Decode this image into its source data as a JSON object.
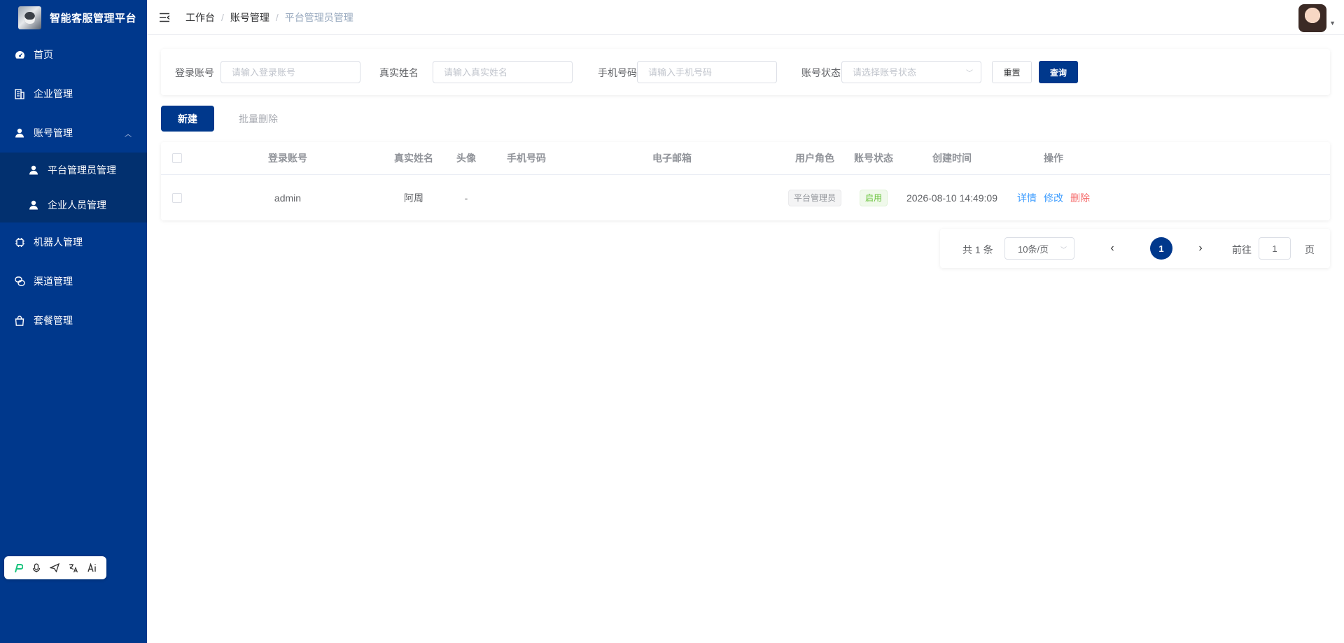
{
  "app": {
    "title": "智能客服管理平台"
  },
  "sidebar": {
    "items": [
      {
        "label": "首页",
        "icon": "dashboard-icon"
      },
      {
        "label": "企业管理",
        "icon": "building-icon"
      },
      {
        "label": "账号管理",
        "icon": "user-icon",
        "expanded": true,
        "children": [
          {
            "label": "平台管理员管理",
            "icon": "user-icon",
            "active": true
          },
          {
            "label": "企业人员管理",
            "icon": "user-icon"
          }
        ]
      },
      {
        "label": "机器人管理",
        "icon": "chip-icon"
      },
      {
        "label": "渠道管理",
        "icon": "channel-icon"
      },
      {
        "label": "套餐管理",
        "icon": "bag-icon"
      }
    ]
  },
  "header": {
    "breadcrumb": [
      "工作台",
      "账号管理",
      "平台管理员管理"
    ]
  },
  "search": {
    "account_label": "登录账号",
    "account_placeholder": "请输入登录账号",
    "name_label": "真实姓名",
    "name_placeholder": "请输入真实姓名",
    "phone_label": "手机号码",
    "phone_placeholder": "请输入手机号码",
    "status_label": "账号状态",
    "status_placeholder": "请选择账号状态",
    "reset_label": "重置",
    "query_label": "查询"
  },
  "actions": {
    "new_label": "新建",
    "batch_delete_label": "批量删除"
  },
  "table": {
    "columns": [
      "登录账号",
      "真实姓名",
      "头像",
      "手机号码",
      "电子邮箱",
      "用户角色",
      "账号状态",
      "创建时间",
      "操作"
    ],
    "rows": [
      {
        "account": "admin",
        "name": "阿周",
        "avatar": "-",
        "phone": "",
        "email": "",
        "role": "平台管理员",
        "status": "启用",
        "created": "2026-08-10 14:49:09",
        "ops": {
          "detail": "详情",
          "edit": "修改",
          "delete": "删除"
        }
      }
    ]
  },
  "pagination": {
    "total_text": "共 1 条",
    "page_size": "10条/页",
    "current_page": "1",
    "goto_label": "前往",
    "goto_value": "1",
    "page_word": "页"
  },
  "colors": {
    "primary": "#00388c",
    "link": "#409eff",
    "danger": "#f56c6c",
    "success": "#67c23a"
  }
}
